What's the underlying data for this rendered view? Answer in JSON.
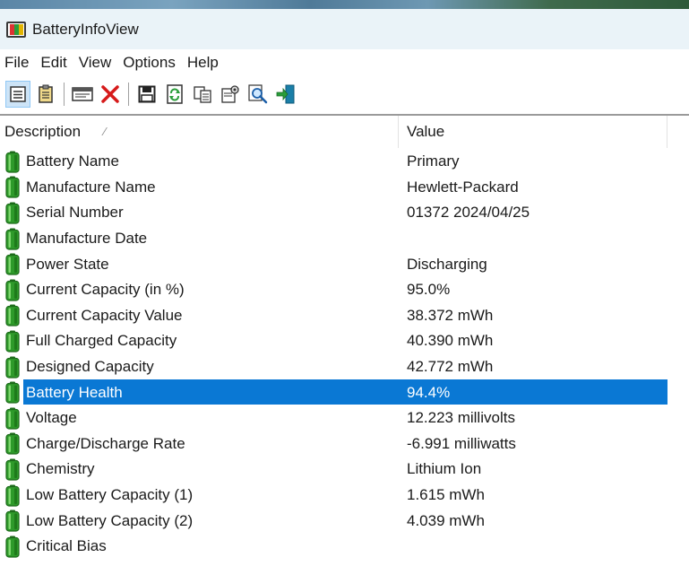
{
  "window": {
    "title": "BatteryInfoView"
  },
  "menu": [
    "File",
    "Edit",
    "View",
    "Options",
    "Help"
  ],
  "toolbar": {
    "buttons": [
      {
        "icon": "list-view-icon",
        "active": true
      },
      {
        "icon": "clipboard-list-icon",
        "active": false
      },
      {
        "icon": "window-properties-icon",
        "active": false
      },
      {
        "icon": "delete-x-icon",
        "active": false
      },
      {
        "icon": "save-disk-icon",
        "active": false
      },
      {
        "icon": "refresh-icon",
        "active": false
      },
      {
        "icon": "copy-icon",
        "active": false
      },
      {
        "icon": "properties-icon",
        "active": false
      },
      {
        "icon": "find-icon",
        "active": false
      },
      {
        "icon": "exit-icon",
        "active": false
      }
    ]
  },
  "columns": {
    "description": "Description",
    "value": "Value"
  },
  "rows": [
    {
      "description": "Battery Name",
      "value": "Primary"
    },
    {
      "description": "Manufacture Name",
      "value": "Hewlett-Packard"
    },
    {
      "description": "Serial Number",
      "value": "01372 2024/04/25"
    },
    {
      "description": "Manufacture Date",
      "value": ""
    },
    {
      "description": "Power State",
      "value": "Discharging"
    },
    {
      "description": "Current Capacity (in %)",
      "value": "95.0%"
    },
    {
      "description": "Current Capacity Value",
      "value": "38.372 mWh"
    },
    {
      "description": "Full Charged Capacity",
      "value": "40.390 mWh"
    },
    {
      "description": "Designed Capacity",
      "value": "42.772 mWh"
    },
    {
      "description": "Battery Health",
      "value": "94.4%",
      "selected": true
    },
    {
      "description": "Voltage",
      "value": "12.223 millivolts"
    },
    {
      "description": "Charge/Discharge Rate",
      "value": "-6.991 milliwatts"
    },
    {
      "description": "Chemistry",
      "value": "Lithium Ion"
    },
    {
      "description": "Low Battery Capacity (1)",
      "value": "1.615 mWh"
    },
    {
      "description": "Low Battery Capacity (2)",
      "value": "4.039 mWh"
    },
    {
      "description": "Critical Bias",
      "value": ""
    }
  ],
  "colors": {
    "selection": "#0a78d4",
    "battery_green": "#2e9a2a"
  }
}
